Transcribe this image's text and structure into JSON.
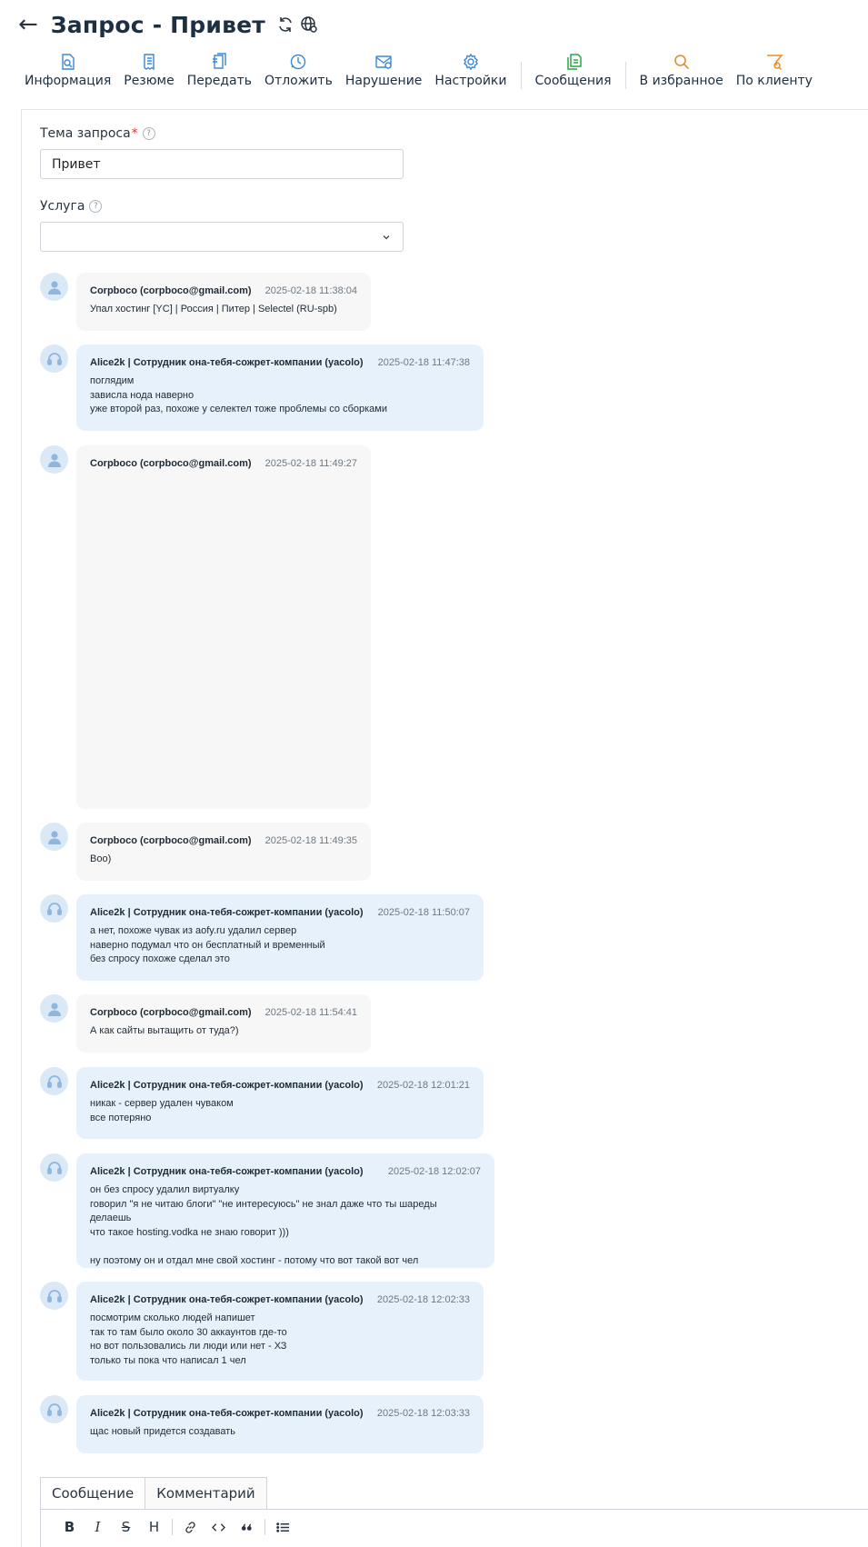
{
  "header": {
    "title": "Запрос - Привет"
  },
  "toolbar": {
    "info": "Информация",
    "summary": "Резюме",
    "transfer": "Передать",
    "postpone": "Отложить",
    "violation": "Нарушение",
    "settings": "Настройки",
    "messages": "Сообщения",
    "favorites": "В избранное",
    "by_client": "По клиенту"
  },
  "form": {
    "subject_label": "Тема запроса",
    "subject_required": "*",
    "subject_value": "Привет",
    "service_label": "Услуга",
    "service_value": "",
    "help_glyph": "?"
  },
  "messages": [
    {
      "kind": "client",
      "author": "Corpboco (corpboco@gmail.com)",
      "time": "2025-02-18 11:38:04",
      "text": "Упал хостинг [YC] | Россия | Питер | Selectel (RU-spb)"
    },
    {
      "kind": "staff",
      "author": "Alice2k | Сотрудник она-тебя-сожрет-компании (yacolo)",
      "time": "2025-02-18 11:47:38",
      "text": "поглядим\nзависла нода наверно\nуже второй раз, похоже у селектел тоже проблемы со сборками"
    },
    {
      "kind": "client",
      "author": "Corpboco (corpboco@gmail.com)",
      "time": "2025-02-18 11:49:27",
      "text": ""
    },
    {
      "kind": "client",
      "author": "Corpboco (corpboco@gmail.com)",
      "time": "2025-02-18 11:49:35",
      "text": "Boo)"
    },
    {
      "kind": "staff",
      "author": "Alice2k | Сотрудник она-тебя-сожрет-компании (yacolo)",
      "time": "2025-02-18 11:50:07",
      "text": "а нет, похоже чувак из aofy.ru удалил сервер\nнаверно подумал что он бесплатный и временный\nбез спросу похоже сделал это"
    },
    {
      "kind": "client",
      "author": "Corpboco (corpboco@gmail.com)",
      "time": "2025-02-18 11:54:41",
      "text": "А как сайты вытащить от туда?)"
    },
    {
      "kind": "staff",
      "author": "Alice2k | Сотрудник она-тебя-сожрет-компании (yacolo)",
      "time": "2025-02-18 12:01:21",
      "text": "никак - сервер удален чуваком\nвсе потеряно"
    },
    {
      "kind": "staff",
      "author": "Alice2k | Сотрудник она-тебя-сожрет-компании (yacolo)",
      "time": "2025-02-18 12:02:07",
      "text": "он без спросу удалил виртуалку\nговорил \"я не читаю блоги\" \"не интересуюсь\" не знал даже что ты шареды делаешь\nчто такое hosting.vodka не знаю говорит )))\n\nну поэтому он и отдал мне свой хостинг - потому что вот такой вот чел"
    },
    {
      "kind": "staff",
      "author": "Alice2k | Сотрудник она-тебя-сожрет-компании (yacolo)",
      "time": "2025-02-18 12:02:33",
      "text": "посмотрим сколько людей напишет\nтак то там было около 30 аккаунтов где-то\nно вот пользовались ли люди или нет - ХЗ\nтолько ты пока что написал 1 чел"
    },
    {
      "kind": "staff",
      "author": "Alice2k | Сотрудник она-тебя-сожрет-компании (yacolo)",
      "time": "2025-02-18 12:03:33",
      "text": "щас новый придется создавать"
    }
  ],
  "composer": {
    "tab_message": "Сообщение",
    "tab_comment": "Комментарий",
    "bold": "B",
    "italic": "I",
    "strike": "S",
    "heading": "H"
  },
  "colors": {
    "accent_blue": "#3b87d6",
    "green": "#27a844",
    "orange": "#f08a1d",
    "staff_bubble": "#e7f1fc",
    "client_bubble": "#f7f7f7"
  }
}
